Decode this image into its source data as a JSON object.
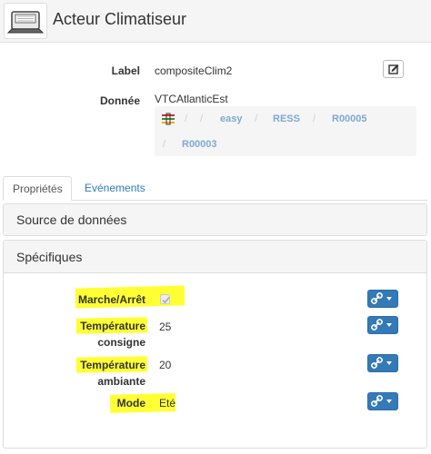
{
  "header": {
    "title": "Acteur Climatiseur",
    "icon": "air-conditioner-icon"
  },
  "info": {
    "label_caption": "Label",
    "label_value": "compositeClim2",
    "donnee_caption": "Donnée",
    "donnee_value": "VTCAtlanticEst",
    "breadcrumb": {
      "icon": "network-icon",
      "separator": "/",
      "items": [
        "easy",
        "RESS",
        "R00005",
        "R00003"
      ]
    }
  },
  "tabs": {
    "properties": "Propriétés",
    "events": "Evénements"
  },
  "panels": {
    "source": "Source de données",
    "specifics": "Spécifiques"
  },
  "fields": {
    "marche": {
      "label": "Marche/Arrêt",
      "checked": true
    },
    "temp_consigne": {
      "label_line1": "Température",
      "label_line2": "consigne",
      "value": "25"
    },
    "temp_ambiante": {
      "label_line1": "Température",
      "label_line2": "ambiante",
      "value": "20"
    },
    "mode": {
      "label": "Mode",
      "value": "Eté"
    }
  },
  "colors": {
    "highlight": "#ffff33",
    "primary_button": "#337ab7",
    "link": "#337ab7",
    "breadcrumb_link": "#7fa9d2"
  }
}
